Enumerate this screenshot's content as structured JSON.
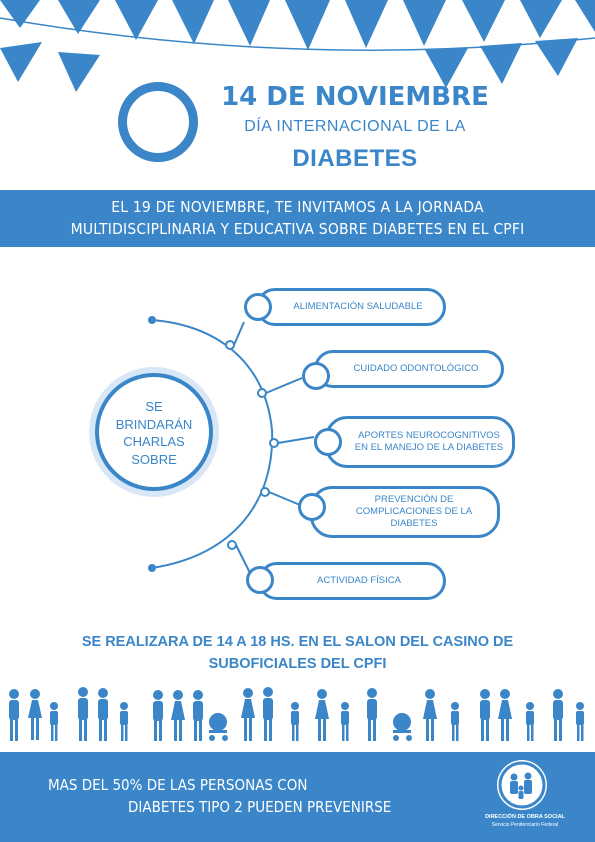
{
  "header": {
    "date": "14 DE NOVIEMBRE",
    "day": "DÍA INTERNACIONAL DE LA",
    "disease": "DIABETES"
  },
  "invite": {
    "line1": "EL 19 DE NOVIEMBRE, TE INVITAMOS A LA  JORNADA",
    "line2": "MULTIDISCIPLINARIA Y EDUCATIVA SOBRE DIABETES EN EL CPFI"
  },
  "center": {
    "line1": "SE",
    "line2": "BRINDARÁN",
    "line3": "CHARLAS",
    "line4": "SOBRE"
  },
  "topics": [
    "ALIMENTACIÓN SALUDABLE",
    "CUIDADO ODONTOLÓGICO",
    "APORTES NEUROCOGNITIVOS EN EL MANEJO DE LA DIABETES",
    "PREVENCIÓN DE COMPLICACIONES DE LA DIABETES",
    "ACTIVIDAD FÍSICA"
  ],
  "schedule": {
    "line1": "SE REALIZARA  DE 14 A 18 HS. EN EL SALON DEL CASINO DE",
    "line2": "SUBOFICIALES DEL CPFI"
  },
  "footer": {
    "line1": "MAS DEL 50% DE LAS PERSONAS CON",
    "line2": "DIABETES TIPO 2 PUEDEN PREVENIRSE",
    "logo_line1": "DIRECCIÓN DE OBRA SOCIAL",
    "logo_line2": "Servicio Penitenciario Federal"
  },
  "colors": {
    "primary": "#3a86c8",
    "light": "#d8e7f5",
    "background": "#ffffff"
  },
  "icons": {
    "bunting": "pennant-bunting-icon",
    "ring": "blue-circle-icon",
    "people": "family-silhouettes-icon",
    "logo": "obra-social-logo-icon"
  }
}
